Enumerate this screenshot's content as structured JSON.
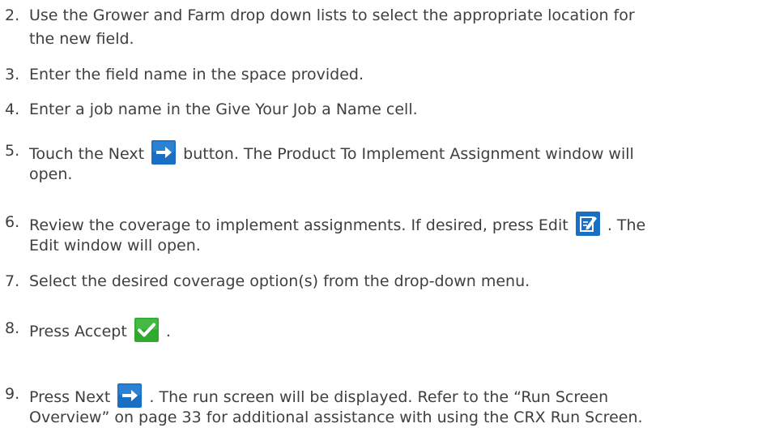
{
  "steps": [
    {
      "number": "2.",
      "lines": [
        "Use the Grower and Farm drop down lists to select the appropriate location for",
        "the new field."
      ]
    },
    {
      "number": "3.",
      "lines": [
        "Enter the field name in the space provided."
      ]
    },
    {
      "number": "4.",
      "lines": [
        "Enter a job name in the Give Your Job a Name cell."
      ]
    },
    {
      "number": "5.",
      "before_icon": "Touch the Next",
      "icon": "next-arrow-icon",
      "after_icon": "button. The Product To Implement Assignment window will",
      "line2": "open."
    },
    {
      "number": "6.",
      "before_icon": "Review the coverage to implement assignments. If desired, press Edit",
      "icon": "edit-icon",
      "after_icon": ". The",
      "line2": "Edit window will open."
    },
    {
      "number": "7.",
      "lines": [
        "Select the desired coverage option(s) from the drop-down menu."
      ]
    },
    {
      "number": "8.",
      "before_icon": "Press Accept",
      "icon": "accept-check-icon",
      "after_icon": "."
    },
    {
      "number": "9.",
      "before_icon": "Press Next",
      "icon": "next-arrow-icon",
      "after_icon": ". The run screen will be displayed. Refer to the “Run Screen",
      "line2": "Overview” on page 33 for additional assistance with using the CRX Run Screen."
    }
  ],
  "colors": {
    "text": "#3f3f3f",
    "icon_blue": "#1a6fc4",
    "icon_blue_light": "#3b8fe0",
    "icon_green": "#2eaa2e"
  }
}
